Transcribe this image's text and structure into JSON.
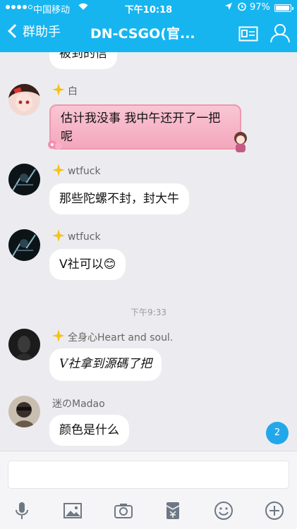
{
  "status_bar": {
    "carrier": "中国移动",
    "time": "下午10:18",
    "battery": "97%"
  },
  "nav": {
    "back_label": "群助手",
    "title": "DN-CSGO(官..."
  },
  "messages": [
    {
      "partial_text": "被到的信"
    },
    {
      "sender": "白",
      "text_line1": "估计我没事 我中午还开了一把",
      "text_line2": "呢"
    },
    {
      "sender": "wtfuck",
      "text": "那些陀螺不封，封大牛"
    },
    {
      "sender": "wtfuck",
      "text": "V社可以😊"
    },
    {
      "sender": "全身心Heart and soul.",
      "text": "V社拿到源碼了把"
    },
    {
      "sender": "迷のMadao",
      "text": "颜色是什么"
    }
  ],
  "timestamp": "下午9:33",
  "unread_count": "2",
  "input": {
    "placeholder": ""
  },
  "toolbar_icons": [
    "microphone-icon",
    "image-icon",
    "camera-icon",
    "red-packet-icon",
    "emoji-icon",
    "plus-icon"
  ],
  "colors": {
    "accent": "#16b5f0",
    "background": "#ececf0",
    "badge": "#22a8ea",
    "pink_bubble": "#f7b7c8"
  }
}
